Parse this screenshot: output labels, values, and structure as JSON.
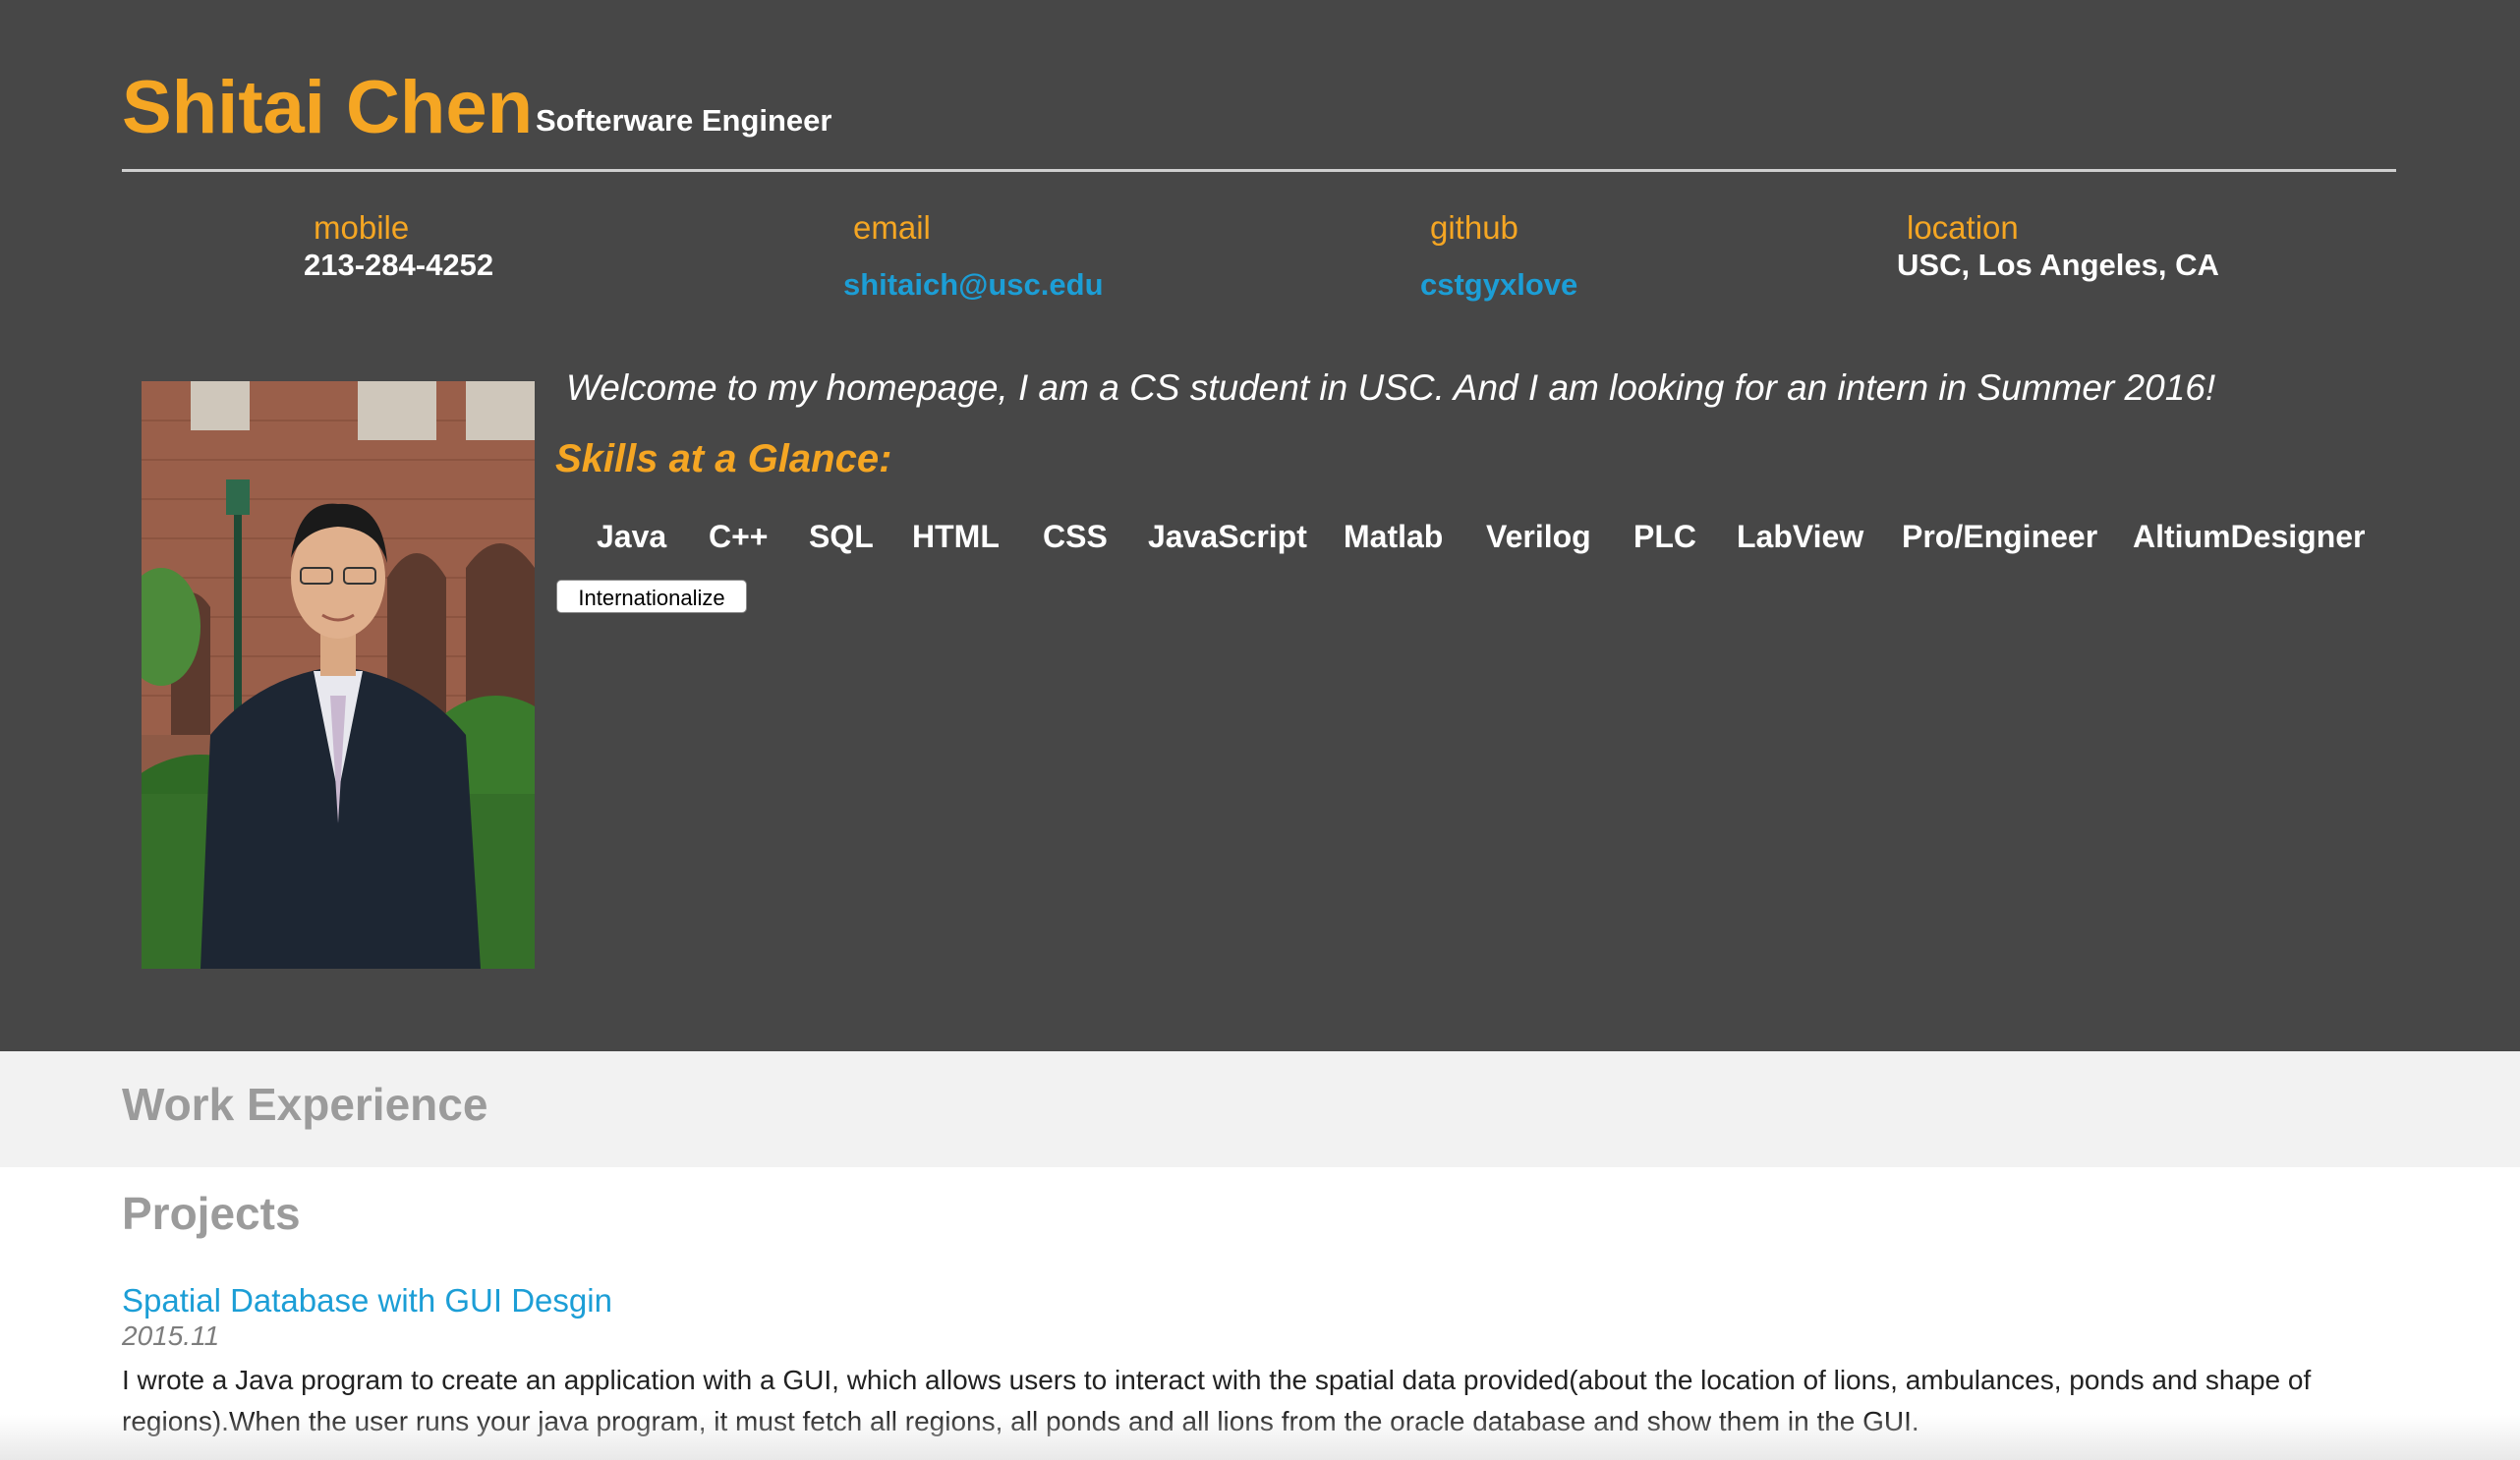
{
  "header": {
    "name": "Shitai Chen",
    "title": "Softerware Engineer"
  },
  "contact": {
    "mobile_label": "mobile",
    "mobile_value": "213-284-4252",
    "email_label": "email",
    "email_value": "shitaich@usc.edu",
    "github_label": "github",
    "github_value": "cstgyxlove",
    "location_label": "location",
    "location_value": "USC, Los Angeles, CA"
  },
  "intro": {
    "welcome": "Welcome to my homepage, I am a CS student in USC. And I am looking for an intern in Summer 2016!",
    "skills_title": "Skills at a Glance:",
    "skills": [
      "Java",
      "C++",
      "SQL",
      "HTML",
      "CSS",
      "JavaScript",
      "Matlab",
      "Verilog",
      "PLC",
      "LabView",
      "Pro/Engineer",
      "AltiumDesigner"
    ],
    "internationalize_button": "Internationalize"
  },
  "sections": {
    "work_experience": "Work Experience",
    "projects": "Projects"
  },
  "projects": [
    {
      "title": "Spatial Database with GUI Desgin",
      "date": "2015.11",
      "description": "I wrote a Java program to create an application with a GUI, which allows users to interact with the spatial data provided(about the location of lions, ambulances, ponds and shape of regions).When the user runs your java program, it must fetch all regions, all ponds and all lions from the oracle database and show them in the GUI."
    }
  ],
  "colors": {
    "accent": "#f5a623",
    "link": "#1c9ed6",
    "header_bg": "#474747"
  }
}
